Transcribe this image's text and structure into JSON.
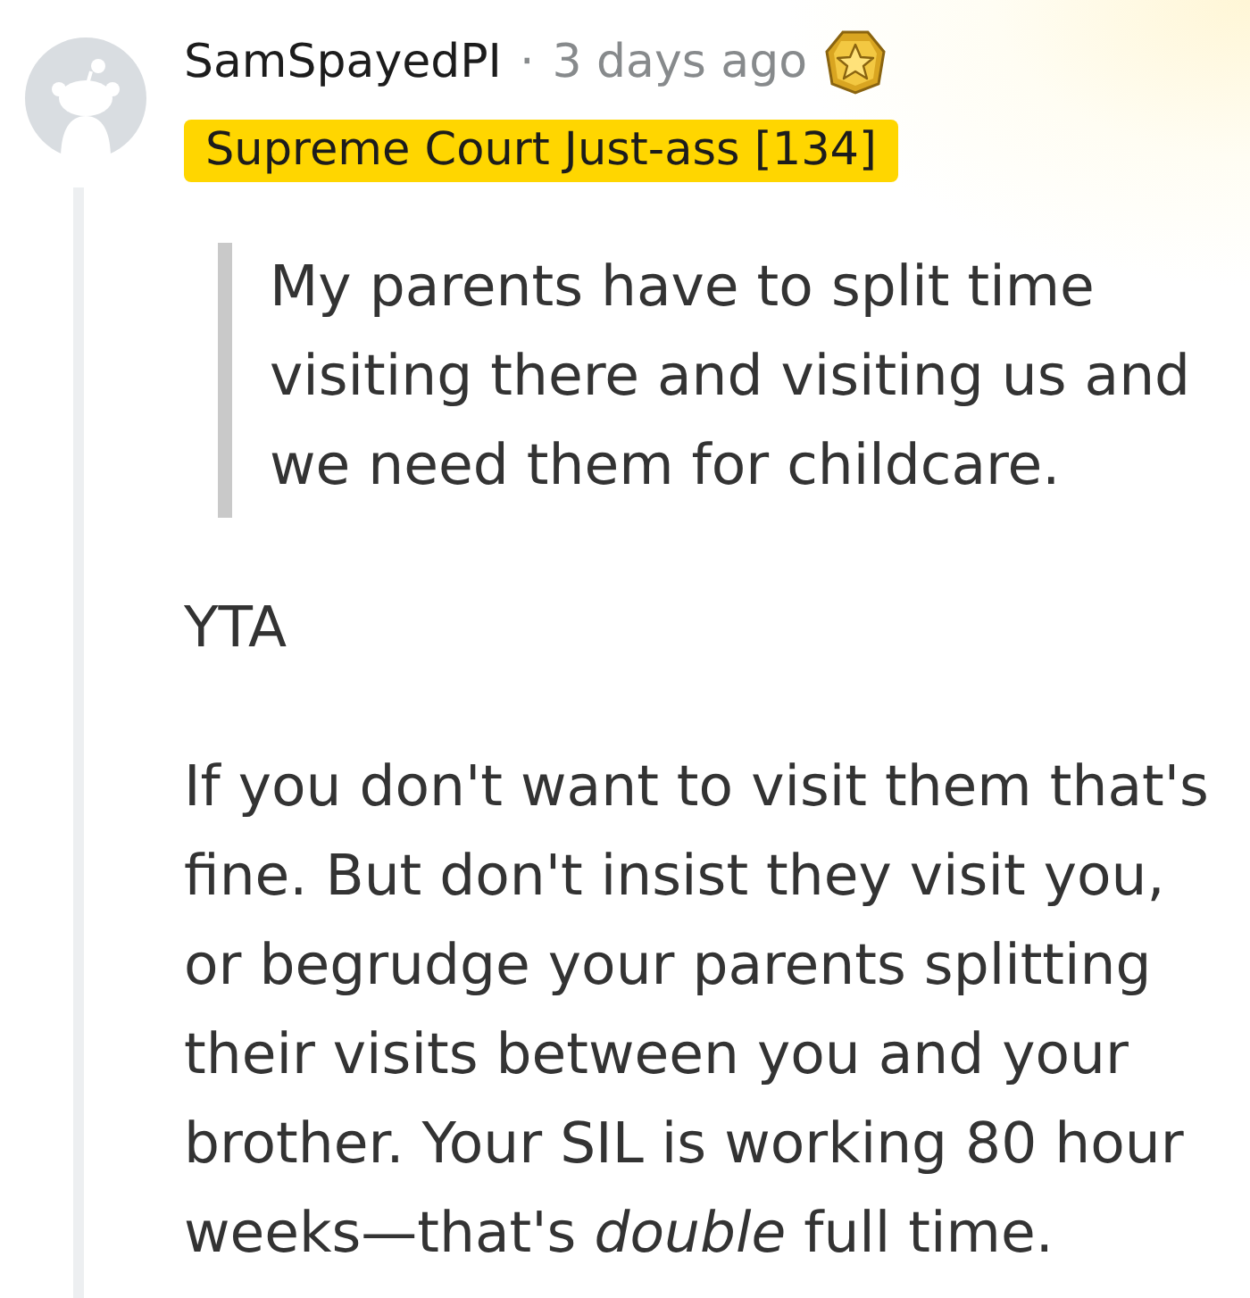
{
  "comment": {
    "author": "SamSpayedPI",
    "separator": "·",
    "time": "3 days ago",
    "flair": "Supreme Court Just-ass [134]",
    "quote": "My parents have to split time visiting there and visiting us and we need them for childcare.",
    "paragraphs": [
      "YTA",
      "If you don't want to visit them that's fine. But don't insist they visit you, or begrudge your parents splitting their visits between you and your brother. Your SIL is working 80 hour weeks—that's *double* full time."
    ]
  }
}
